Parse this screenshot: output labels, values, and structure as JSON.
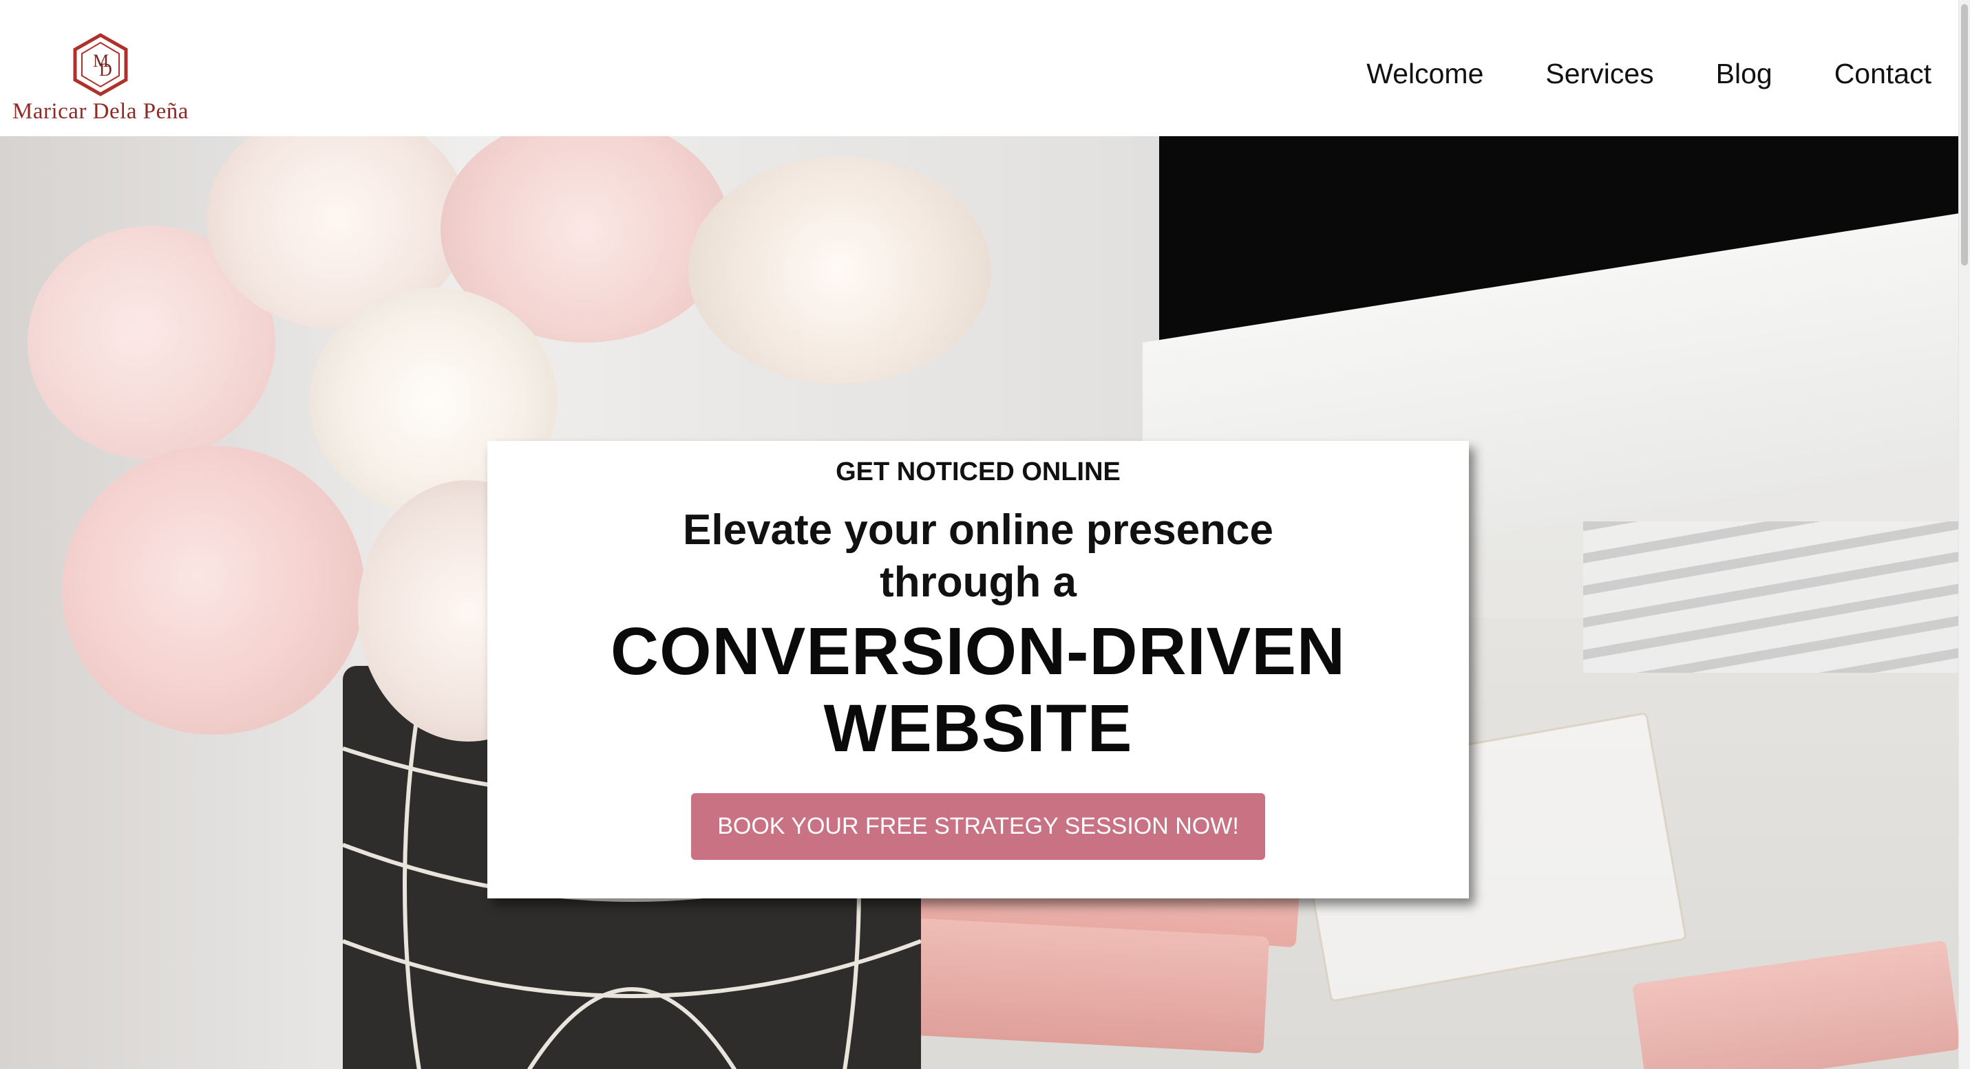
{
  "brand": {
    "logo_initials": "MD",
    "name": "Maricar Dela Peña",
    "color": "#8f2a26"
  },
  "nav": {
    "items": [
      {
        "label": "Welcome"
      },
      {
        "label": "Services"
      },
      {
        "label": "Blog"
      },
      {
        "label": "Contact"
      }
    ]
  },
  "hero": {
    "eyebrow": "GET NOTICED ONLINE",
    "headline_line1": "Elevate your online presence",
    "headline_line2": "through a",
    "highlight_line1": "CONVERSION-DRIVEN",
    "highlight_line2": "WEBSITE",
    "cta_label": "BOOK YOUR FREE STRATEGY SESSION NOW!",
    "cta_color": "#c97283"
  }
}
